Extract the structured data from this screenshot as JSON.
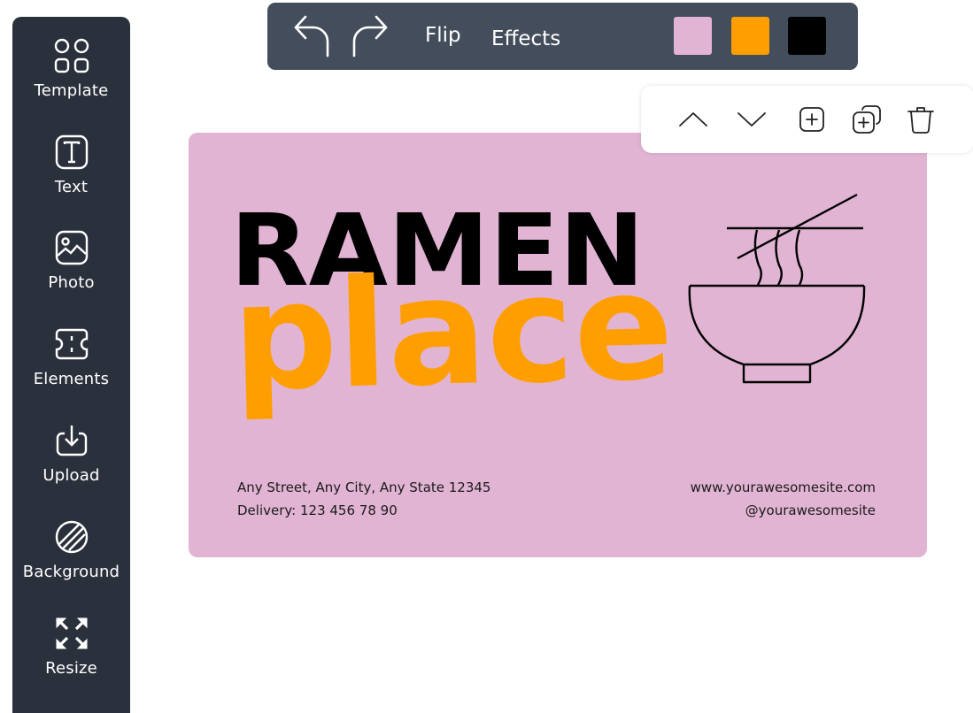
{
  "sidebar": {
    "items": [
      {
        "label": "Template",
        "icon": "template-grid-icon"
      },
      {
        "label": "Text",
        "icon": "text-box-icon"
      },
      {
        "label": "Photo",
        "icon": "photo-icon"
      },
      {
        "label": "Elements",
        "icon": "elements-ticket-icon"
      },
      {
        "label": "Upload",
        "icon": "upload-icon"
      },
      {
        "label": "Background",
        "icon": "background-stripes-icon"
      },
      {
        "label": "Resize",
        "icon": "resize-arrows-icon"
      }
    ]
  },
  "toolbar": {
    "undo_icon": "undo-arrow-icon",
    "redo_icon": "redo-arrow-icon",
    "flip_label": "Flip",
    "effects_label": "Effects",
    "swatches": [
      "#e2b4d4",
      "#ff9e00",
      "#000000"
    ]
  },
  "actions": {
    "icons": [
      "chevron-up-icon",
      "chevron-down-icon",
      "add-page-icon",
      "duplicate-page-icon",
      "trash-icon"
    ]
  },
  "card": {
    "background": "#e2b4d4",
    "title_line1": "RAMEN",
    "title_line2": "place",
    "title_color": "#000000",
    "accent_color": "#ff9e00",
    "address": "Any Street, Any City, Any State 12345",
    "delivery": "Delivery: 123 456 78 90",
    "website": "www.yourawesomesite.com",
    "social": "@yourawesomesite",
    "illustration": "ramen-bowl-icon"
  }
}
